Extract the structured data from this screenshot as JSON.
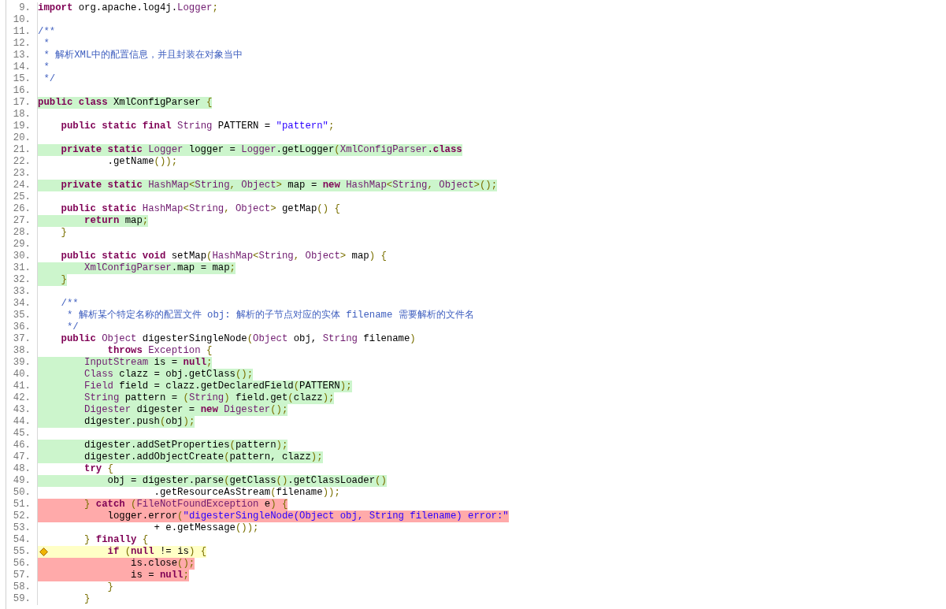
{
  "lines": [
    {
      "number": "9.",
      "tokens": [
        {
          "text": "import",
          "kind": "keyword"
        },
        {
          "text": " org.apache.log4j.",
          "kind": "plain"
        },
        {
          "text": "Logger",
          "kind": "type"
        },
        {
          "text": ";",
          "kind": "punct"
        }
      ]
    },
    {
      "number": "10."
    },
    {
      "number": "11.",
      "tokens": [
        {
          "text": "/**",
          "kind": "comment"
        }
      ]
    },
    {
      "number": "12.",
      "tokens": [
        {
          "text": " *",
          "kind": "comment"
        }
      ]
    },
    {
      "number": "13.",
      "tokens": [
        {
          "text": " * 解析XML中的配置信息，并且封装在对象当中",
          "kind": "comment"
        }
      ]
    },
    {
      "number": "14.",
      "tokens": [
        {
          "text": " *",
          "kind": "comment"
        }
      ]
    },
    {
      "number": "15.",
      "tokens": [
        {
          "text": " */",
          "kind": "comment"
        }
      ]
    },
    {
      "number": "16."
    },
    {
      "number": "17.",
      "color": "#ccf5cc",
      "tokens": [
        {
          "text": "public class",
          "kind": "keyword"
        },
        {
          "text": " XmlConfigParser ",
          "kind": "plain"
        },
        {
          "text": "{",
          "kind": "punct"
        }
      ]
    },
    {
      "number": "18."
    },
    {
      "number": "19.",
      "tokens": [
        {
          "text": "    public static final",
          "kind": "keyword"
        },
        {
          "text": " String",
          "kind": "type"
        },
        {
          "text": " PATTERN = ",
          "kind": "plain"
        },
        {
          "text": "\"pattern\"",
          "kind": "string"
        },
        {
          "text": ";",
          "kind": "punct"
        }
      ]
    },
    {
      "number": "20."
    },
    {
      "number": "21.",
      "color": "#ccf5cc",
      "tokens": [
        {
          "text": "    private static",
          "kind": "keyword"
        },
        {
          "text": " Logger",
          "kind": "type"
        },
        {
          "text": " logger = ",
          "kind": "plain"
        },
        {
          "text": "Logger",
          "kind": "type"
        },
        {
          "text": ".getLogger",
          "kind": "plain"
        },
        {
          "text": "(",
          "kind": "punct"
        },
        {
          "text": "XmlConfigParser",
          "kind": "type"
        },
        {
          "text": ".",
          "kind": "plain"
        },
        {
          "text": "class",
          "kind": "keyword"
        }
      ]
    },
    {
      "number": "22.",
      "tokens": [
        {
          "text": "            .getName",
          "kind": "plain"
        },
        {
          "text": "());",
          "kind": "punct"
        }
      ]
    },
    {
      "number": "23."
    },
    {
      "number": "24.",
      "color": "#ccf5cc",
      "tokens": [
        {
          "text": "    private static",
          "kind": "keyword"
        },
        {
          "text": " HashMap",
          "kind": "type"
        },
        {
          "text": "<",
          "kind": "punct"
        },
        {
          "text": "String",
          "kind": "type"
        },
        {
          "text": ", ",
          "kind": "punct"
        },
        {
          "text": "Object",
          "kind": "type"
        },
        {
          "text": ">",
          "kind": "punct"
        },
        {
          "text": " map = ",
          "kind": "plain"
        },
        {
          "text": "new",
          "kind": "keyword"
        },
        {
          "text": " HashMap",
          "kind": "type"
        },
        {
          "text": "<",
          "kind": "punct"
        },
        {
          "text": "String",
          "kind": "type"
        },
        {
          "text": ", ",
          "kind": "punct"
        },
        {
          "text": "Object",
          "kind": "type"
        },
        {
          "text": ">();",
          "kind": "punct"
        }
      ]
    },
    {
      "number": "25."
    },
    {
      "number": "26.",
      "tokens": [
        {
          "text": "    public static",
          "kind": "keyword"
        },
        {
          "text": " HashMap",
          "kind": "type"
        },
        {
          "text": "<",
          "kind": "punct"
        },
        {
          "text": "String",
          "kind": "type"
        },
        {
          "text": ", ",
          "kind": "punct"
        },
        {
          "text": "Object",
          "kind": "type"
        },
        {
          "text": ">",
          "kind": "punct"
        },
        {
          "text": " getMap",
          "kind": "plain"
        },
        {
          "text": "() {",
          "kind": "punct"
        }
      ]
    },
    {
      "number": "27.",
      "color": "#ccf5cc",
      "tokens": [
        {
          "text": "        return",
          "kind": "keyword"
        },
        {
          "text": " map",
          "kind": "plain"
        },
        {
          "text": ";",
          "kind": "punct"
        }
      ]
    },
    {
      "number": "28.",
      "tokens": [
        {
          "text": "    }",
          "kind": "punct"
        }
      ]
    },
    {
      "number": "29."
    },
    {
      "number": "30.",
      "tokens": [
        {
          "text": "    public static void",
          "kind": "keyword"
        },
        {
          "text": " setMap",
          "kind": "plain"
        },
        {
          "text": "(",
          "kind": "punct"
        },
        {
          "text": "HashMap",
          "kind": "type"
        },
        {
          "text": "<",
          "kind": "punct"
        },
        {
          "text": "String",
          "kind": "type"
        },
        {
          "text": ", ",
          "kind": "punct"
        },
        {
          "text": "Object",
          "kind": "type"
        },
        {
          "text": ">",
          "kind": "punct"
        },
        {
          "text": " map",
          "kind": "plain"
        },
        {
          "text": ") {",
          "kind": "punct"
        }
      ]
    },
    {
      "number": "31.",
      "color": "#ccf5cc",
      "tokens": [
        {
          "text": "        XmlConfigParser",
          "kind": "type"
        },
        {
          "text": ".map = map",
          "kind": "plain"
        },
        {
          "text": ";",
          "kind": "punct"
        }
      ]
    },
    {
      "number": "32.",
      "color": "#ccf5cc",
      "tokens": [
        {
          "text": "    }",
          "kind": "punct"
        }
      ]
    },
    {
      "number": "33."
    },
    {
      "number": "34.",
      "tokens": [
        {
          "text": "    /**",
          "kind": "comment"
        }
      ]
    },
    {
      "number": "35.",
      "tokens": [
        {
          "text": "     * 解析某个特定名称的配置文件 obj: 解析的子节点对应的实体 filename 需要解析的文件名",
          "kind": "comment"
        }
      ]
    },
    {
      "number": "36.",
      "tokens": [
        {
          "text": "     */",
          "kind": "comment"
        }
      ]
    },
    {
      "number": "37.",
      "tokens": [
        {
          "text": "    public",
          "kind": "keyword"
        },
        {
          "text": " Object",
          "kind": "type"
        },
        {
          "text": " digesterSingleNode",
          "kind": "plain"
        },
        {
          "text": "(",
          "kind": "punct"
        },
        {
          "text": "Object",
          "kind": "type"
        },
        {
          "text": " obj, ",
          "kind": "plain"
        },
        {
          "text": "String",
          "kind": "type"
        },
        {
          "text": " filename",
          "kind": "plain"
        },
        {
          "text": ")",
          "kind": "punct"
        }
      ]
    },
    {
      "number": "38.",
      "tokens": [
        {
          "text": "            throws",
          "kind": "keyword"
        },
        {
          "text": " Exception",
          "kind": "type"
        },
        {
          "text": " {",
          "kind": "punct"
        }
      ]
    },
    {
      "number": "39.",
      "color": "#ccf5cc",
      "tokens": [
        {
          "text": "        InputStream",
          "kind": "type"
        },
        {
          "text": " is = ",
          "kind": "plain"
        },
        {
          "text": "null",
          "kind": "keyword"
        },
        {
          "text": ";",
          "kind": "punct"
        }
      ]
    },
    {
      "number": "40.",
      "color": "#ccf5cc",
      "tokens": [
        {
          "text": "        Class",
          "kind": "type"
        },
        {
          "text": " clazz = obj.getClass",
          "kind": "plain"
        },
        {
          "text": "();",
          "kind": "punct"
        }
      ]
    },
    {
      "number": "41.",
      "color": "#ccf5cc",
      "tokens": [
        {
          "text": "        Field",
          "kind": "type"
        },
        {
          "text": " field = clazz.getDeclaredField",
          "kind": "plain"
        },
        {
          "text": "(",
          "kind": "punct"
        },
        {
          "text": "PATTERN",
          "kind": "plain"
        },
        {
          "text": ");",
          "kind": "punct"
        }
      ]
    },
    {
      "number": "42.",
      "color": "#ccf5cc",
      "tokens": [
        {
          "text": "        String",
          "kind": "type"
        },
        {
          "text": " pattern = ",
          "kind": "plain"
        },
        {
          "text": "(",
          "kind": "punct"
        },
        {
          "text": "String",
          "kind": "type"
        },
        {
          "text": ")",
          "kind": "punct"
        },
        {
          "text": " field.get",
          "kind": "plain"
        },
        {
          "text": "(",
          "kind": "punct"
        },
        {
          "text": "clazz",
          "kind": "plain"
        },
        {
          "text": ");",
          "kind": "punct"
        }
      ]
    },
    {
      "number": "43.",
      "color": "#ccf5cc",
      "tokens": [
        {
          "text": "        Digester",
          "kind": "type"
        },
        {
          "text": " digester = ",
          "kind": "plain"
        },
        {
          "text": "new",
          "kind": "keyword"
        },
        {
          "text": " Digester",
          "kind": "type"
        },
        {
          "text": "();",
          "kind": "punct"
        }
      ]
    },
    {
      "number": "44.",
      "color": "#ccf5cc",
      "tokens": [
        {
          "text": "        digester.push",
          "kind": "plain"
        },
        {
          "text": "(",
          "kind": "punct"
        },
        {
          "text": "obj",
          "kind": "plain"
        },
        {
          "text": ");",
          "kind": "punct"
        }
      ]
    },
    {
      "number": "45."
    },
    {
      "number": "46.",
      "color": "#ccf5cc",
      "tokens": [
        {
          "text": "        digester.addSetProperties",
          "kind": "plain"
        },
        {
          "text": "(",
          "kind": "punct"
        },
        {
          "text": "pattern",
          "kind": "plain"
        },
        {
          "text": ");",
          "kind": "punct"
        }
      ]
    },
    {
      "number": "47.",
      "color": "#ccf5cc",
      "tokens": [
        {
          "text": "        digester.addObjectCreate",
          "kind": "plain"
        },
        {
          "text": "(",
          "kind": "punct"
        },
        {
          "text": "pattern, clazz",
          "kind": "plain"
        },
        {
          "text": ");",
          "kind": "punct"
        }
      ]
    },
    {
      "number": "48.",
      "tokens": [
        {
          "text": "        try",
          "kind": "keyword"
        },
        {
          "text": " {",
          "kind": "punct"
        }
      ]
    },
    {
      "number": "49.",
      "color": "#ccf5cc",
      "tokens": [
        {
          "text": "            obj = digester.parse",
          "kind": "plain"
        },
        {
          "text": "(",
          "kind": "punct"
        },
        {
          "text": "getClass",
          "kind": "plain"
        },
        {
          "text": "()",
          "kind": "punct"
        },
        {
          "text": ".getClassLoader",
          "kind": "plain"
        },
        {
          "text": "()",
          "kind": "punct"
        }
      ]
    },
    {
      "number": "50.",
      "tokens": [
        {
          "text": "                    .getResourceAsStream",
          "kind": "plain"
        },
        {
          "text": "(",
          "kind": "punct"
        },
        {
          "text": "filename",
          "kind": "plain"
        },
        {
          "text": "));",
          "kind": "punct"
        }
      ]
    },
    {
      "number": "51.",
      "color": "#ffaaaa",
      "tokens": [
        {
          "text": "        }",
          "kind": "punct"
        },
        {
          "text": " catch",
          "kind": "keyword"
        },
        {
          "text": " (",
          "kind": "punct"
        },
        {
          "text": "FileNotFoundException",
          "kind": "type"
        },
        {
          "text": " e",
          "kind": "plain"
        },
        {
          "text": ") {",
          "kind": "punct"
        }
      ]
    },
    {
      "number": "52.",
      "color": "#ffaaaa",
      "tokens": [
        {
          "text": "            logger.error",
          "kind": "plain"
        },
        {
          "text": "(",
          "kind": "punct"
        },
        {
          "text": "\"digesterSingleNode(Object obj, String filename) error:\"",
          "kind": "string"
        }
      ]
    },
    {
      "number": "53.",
      "tokens": [
        {
          "text": "                    + e.getMessage",
          "kind": "plain"
        },
        {
          "text": "());",
          "kind": "punct"
        }
      ]
    },
    {
      "number": "54.",
      "tokens": [
        {
          "text": "        }",
          "kind": "punct"
        },
        {
          "text": " finally",
          "kind": "keyword"
        },
        {
          "text": " {",
          "kind": "punct"
        }
      ]
    },
    {
      "number": "55.",
      "color": "#ffffc6",
      "branch_marker": true,
      "tokens": [
        {
          "text": "            if",
          "kind": "keyword"
        },
        {
          "text": " (",
          "kind": "punct"
        },
        {
          "text": "null",
          "kind": "keyword"
        },
        {
          "text": " != is",
          "kind": "plain"
        },
        {
          "text": ") {",
          "kind": "punct"
        }
      ]
    },
    {
      "number": "56.",
      "color": "#ffaaaa",
      "tokens": [
        {
          "text": "                is.close",
          "kind": "plain"
        },
        {
          "text": "();",
          "kind": "punct"
        }
      ]
    },
    {
      "number": "57.",
      "color": "#ffaaaa",
      "tokens": [
        {
          "text": "                is = ",
          "kind": "plain"
        },
        {
          "text": "null",
          "kind": "keyword"
        },
        {
          "text": ";",
          "kind": "punct"
        }
      ]
    },
    {
      "number": "58.",
      "tokens": [
        {
          "text": "            }",
          "kind": "punct"
        }
      ]
    },
    {
      "number": "59.",
      "tokens": [
        {
          "text": "        }",
          "kind": "punct"
        }
      ]
    }
  ]
}
